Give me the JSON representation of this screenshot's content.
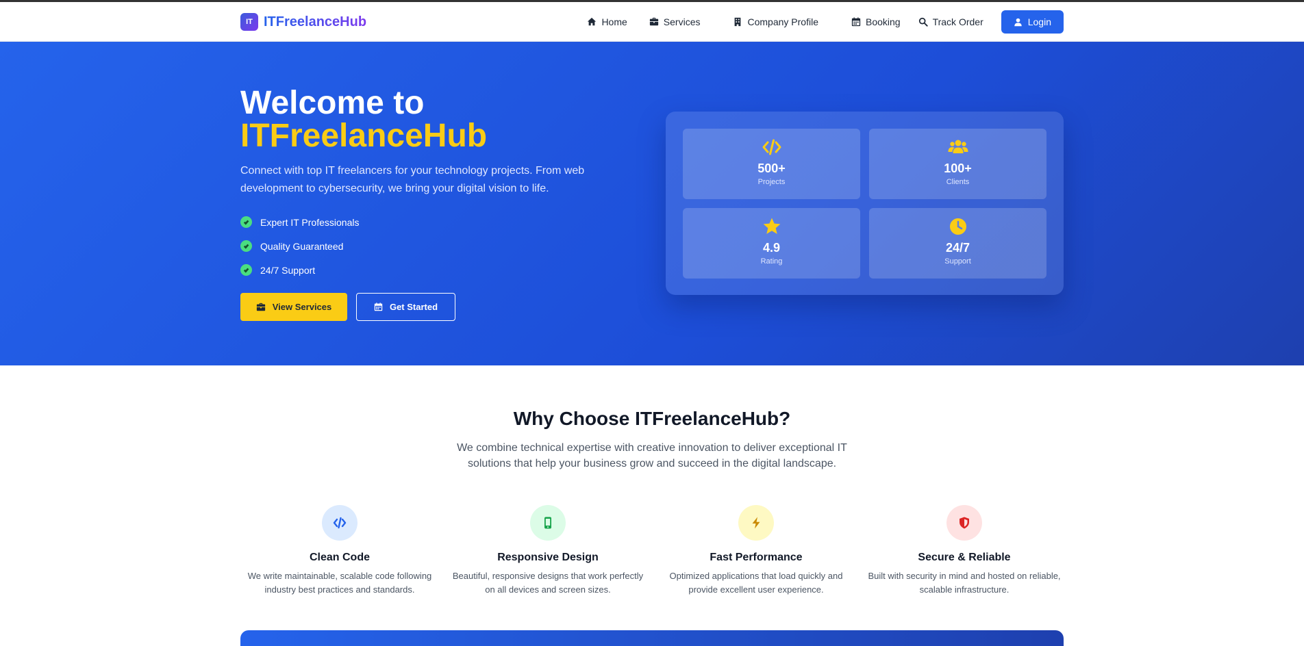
{
  "nav": {
    "logo_text": "IT",
    "brand": "ITFreelanceHub",
    "links": [
      {
        "label": "Home",
        "icon": "home-icon"
      },
      {
        "label": "Services",
        "icon": "briefcase-icon"
      },
      {
        "label": "Company Profile",
        "icon": "building-icon"
      },
      {
        "label": "Booking",
        "icon": "calendar-icon"
      },
      {
        "label": "Track Order",
        "icon": "search-icon"
      }
    ],
    "login": "Login"
  },
  "hero": {
    "title_line1": "Welcome to",
    "title_line2": "ITFreelanceHub",
    "subtitle": "Connect with top IT freelancers for your technology projects. From web development to cybersecurity, we bring your digital vision to life.",
    "checks": [
      "Expert IT Professionals",
      "Quality Guaranteed",
      "24/7 Support"
    ],
    "btn_services": "View Services",
    "btn_started": "Get Started",
    "stats": [
      {
        "value": "500+",
        "label": "Projects",
        "icon": "code-icon"
      },
      {
        "value": "100+",
        "label": "Clients",
        "icon": "users-icon"
      },
      {
        "value": "4.9",
        "label": "Rating",
        "icon": "star-icon"
      },
      {
        "value": "24/7",
        "label": "Support",
        "icon": "clock-icon"
      }
    ]
  },
  "why": {
    "title": "Why Choose ITFreelanceHub?",
    "subtitle": "We combine technical expertise with creative innovation to deliver exceptional IT solutions that help your business grow and succeed in the digital landscape.",
    "features": [
      {
        "title": "Clean Code",
        "desc": "We write maintainable, scalable code following industry best practices and standards.",
        "icon": "code-icon",
        "bg": "#dbeafe",
        "fg": "#2563eb"
      },
      {
        "title": "Responsive Design",
        "desc": "Beautiful, responsive designs that work perfectly on all devices and screen sizes.",
        "icon": "mobile-icon",
        "bg": "#dcfce7",
        "fg": "#16a34a"
      },
      {
        "title": "Fast Performance",
        "desc": "Optimized applications that load quickly and provide excellent user experience.",
        "icon": "bolt-icon",
        "bg": "#fef9c3",
        "fg": "#ca8a04"
      },
      {
        "title": "Secure & Reliable",
        "desc": "Built with security in mind and hosted on reliable, scalable infrastructure.",
        "icon": "shield-icon",
        "bg": "#fee2e2",
        "fg": "#dc2626"
      }
    ]
  },
  "colors": {
    "primary": "#2563eb",
    "accent": "#facc15",
    "check": "#4ade80"
  }
}
